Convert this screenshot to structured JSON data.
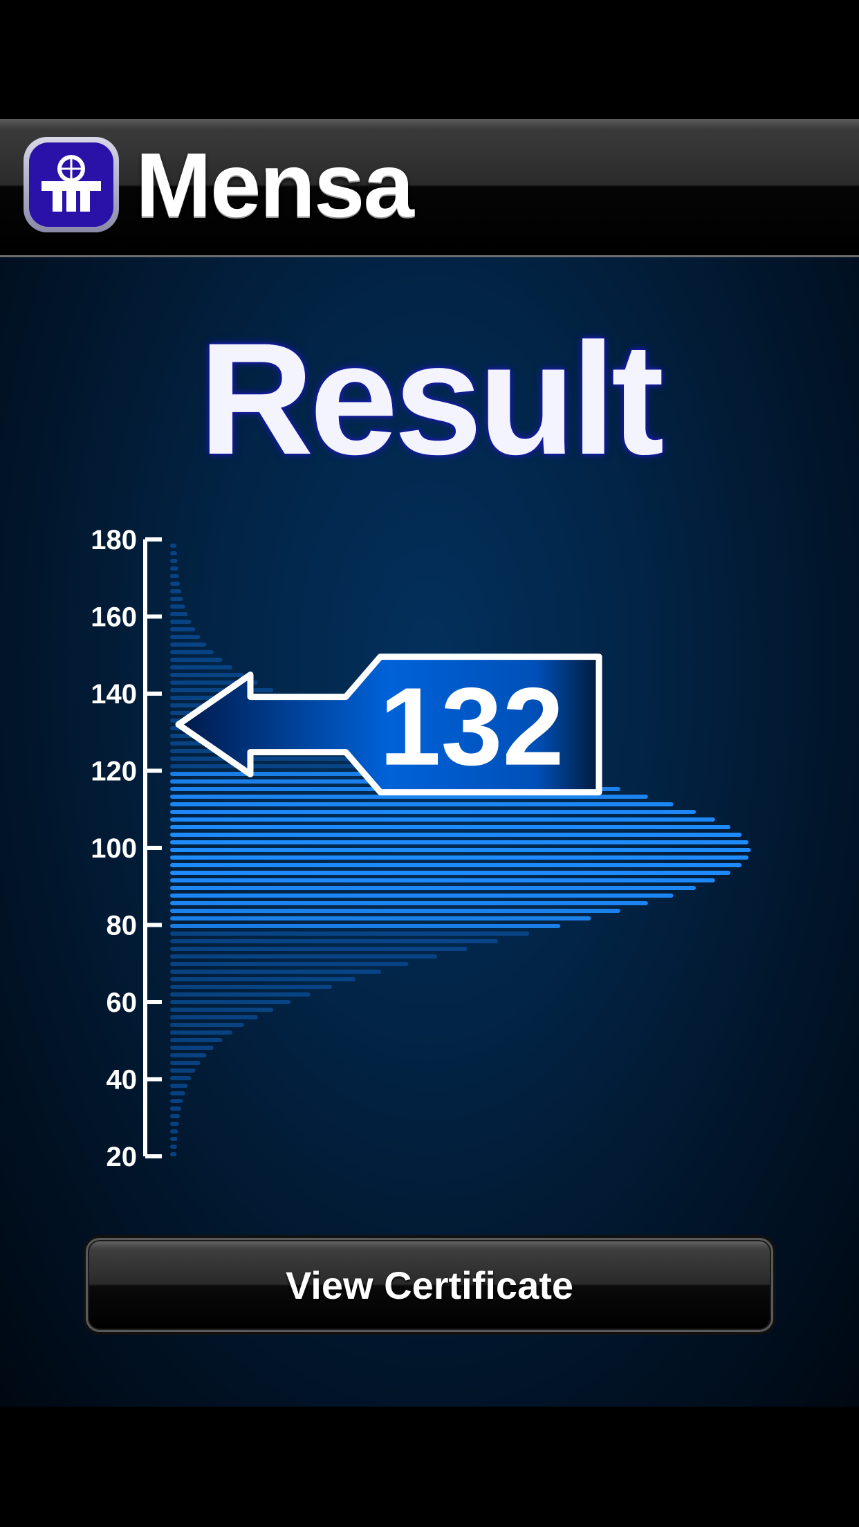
{
  "header": {
    "brand_name": "Mensa",
    "logo_icon": "mensa-logo-icon"
  },
  "result": {
    "title": "Result",
    "score": "132"
  },
  "chart_data": {
    "type": "bar",
    "orientation": "horizontal",
    "description_type": "iq-distribution",
    "y_ticks": [
      180,
      160,
      140,
      120,
      100,
      80,
      60,
      40,
      20
    ],
    "ylim": [
      20,
      180
    ],
    "marker_value": 132,
    "accent_color": "#1e8cff",
    "faded_color": "#0b4f9a"
  },
  "actions": {
    "view_certificate_label": "View Certificate"
  }
}
